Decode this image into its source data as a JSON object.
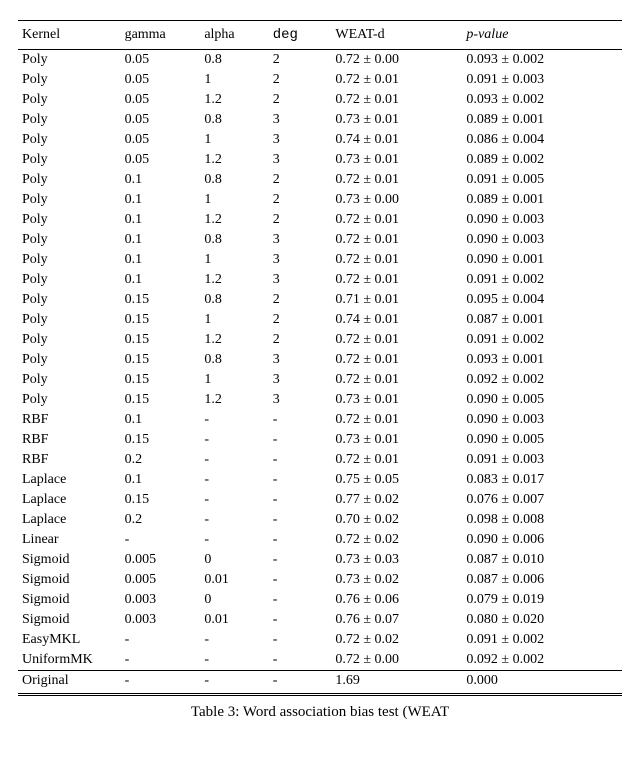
{
  "headers": [
    "Kernel",
    "gamma",
    "alpha",
    "deg",
    "WEAT-d",
    "p-value"
  ],
  "header_italic": [
    false,
    false,
    false,
    false,
    false,
    true
  ],
  "header_mono": [
    false,
    false,
    false,
    true,
    false,
    false
  ],
  "rows": [
    [
      "Poly",
      "0.05",
      "0.8",
      "2",
      "0.72 ± 0.00",
      "0.093 ± 0.002"
    ],
    [
      "Poly",
      "0.05",
      "1",
      "2",
      "0.72 ± 0.01",
      "0.091 ± 0.003"
    ],
    [
      "Poly",
      "0.05",
      "1.2",
      "2",
      "0.72 ± 0.01",
      "0.093 ± 0.002"
    ],
    [
      "Poly",
      "0.05",
      "0.8",
      "3",
      "0.73 ± 0.01",
      "0.089 ± 0.001"
    ],
    [
      "Poly",
      "0.05",
      "1",
      "3",
      "0.74 ± 0.01",
      "0.086 ± 0.004"
    ],
    [
      "Poly",
      "0.05",
      "1.2",
      "3",
      "0.73 ± 0.01",
      "0.089 ± 0.002"
    ],
    [
      "Poly",
      "0.1",
      "0.8",
      "2",
      "0.72 ± 0.01",
      "0.091 ± 0.005"
    ],
    [
      "Poly",
      "0.1",
      "1",
      "2",
      "0.73 ± 0.00",
      "0.089 ± 0.001"
    ],
    [
      "Poly",
      "0.1",
      "1.2",
      "2",
      "0.72 ± 0.01",
      "0.090 ± 0.003"
    ],
    [
      "Poly",
      "0.1",
      "0.8",
      "3",
      "0.72 ± 0.01",
      "0.090 ± 0.003"
    ],
    [
      "Poly",
      "0.1",
      "1",
      "3",
      "0.72 ± 0.01",
      "0.090 ± 0.001"
    ],
    [
      "Poly",
      "0.1",
      "1.2",
      "3",
      "0.72 ± 0.01",
      "0.091 ± 0.002"
    ],
    [
      "Poly",
      "0.15",
      "0.8",
      "2",
      "0.71 ± 0.01",
      "0.095 ± 0.004"
    ],
    [
      "Poly",
      "0.15",
      "1",
      "2",
      "0.74 ± 0.01",
      "0.087 ± 0.001"
    ],
    [
      "Poly",
      "0.15",
      "1.2",
      "2",
      "0.72 ± 0.01",
      "0.091 ± 0.002"
    ],
    [
      "Poly",
      "0.15",
      "0.8",
      "3",
      "0.72 ± 0.01",
      "0.093 ± 0.001"
    ],
    [
      "Poly",
      "0.15",
      "1",
      "3",
      "0.72 ± 0.01",
      "0.092 ± 0.002"
    ],
    [
      "Poly",
      "0.15",
      "1.2",
      "3",
      "0.73 ± 0.01",
      "0.090 ± 0.005"
    ],
    [
      "RBF",
      "0.1",
      "-",
      "-",
      "0.72 ± 0.01",
      "0.090 ± 0.003"
    ],
    [
      "RBF",
      "0.15",
      "-",
      "-",
      "0.73 ± 0.01",
      "0.090 ± 0.005"
    ],
    [
      "RBF",
      "0.2",
      "-",
      "-",
      "0.72 ± 0.01",
      "0.091 ± 0.003"
    ],
    [
      "Laplace",
      "0.1",
      "-",
      "-",
      "0.75 ± 0.05",
      "0.083 ± 0.017"
    ],
    [
      "Laplace",
      "0.15",
      "-",
      "-",
      "0.77 ± 0.02",
      "0.076 ± 0.007"
    ],
    [
      "Laplace",
      "0.2",
      "-",
      "-",
      "0.70 ± 0.02",
      "0.098 ± 0.008"
    ],
    [
      "Linear",
      "-",
      "-",
      "-",
      "0.72 ± 0.02",
      "0.090 ± 0.006"
    ],
    [
      "Sigmoid",
      "0.005",
      "0",
      "-",
      "0.73 ± 0.03",
      "0.087 ± 0.010"
    ],
    [
      "Sigmoid",
      "0.005",
      "0.01",
      "-",
      "0.73 ± 0.02",
      "0.087 ± 0.006"
    ],
    [
      "Sigmoid",
      "0.003",
      "0",
      "-",
      "0.76 ± 0.06",
      "0.079 ± 0.019"
    ],
    [
      "Sigmoid",
      "0.003",
      "0.01",
      "-",
      "0.76 ± 0.07",
      "0.080 ± 0.020"
    ],
    [
      "EasyMKL",
      "-",
      "-",
      "-",
      "0.72 ± 0.02",
      "0.091 ± 0.002"
    ],
    [
      "UniformMK",
      "-",
      "-",
      "-",
      "0.72 ± 0.00",
      "0.092 ± 0.002"
    ]
  ],
  "original_row": [
    "Original",
    "-",
    "-",
    "-",
    "1.69",
    "0.000"
  ],
  "caption": "Table 3: Word association bias test (WEAT"
}
